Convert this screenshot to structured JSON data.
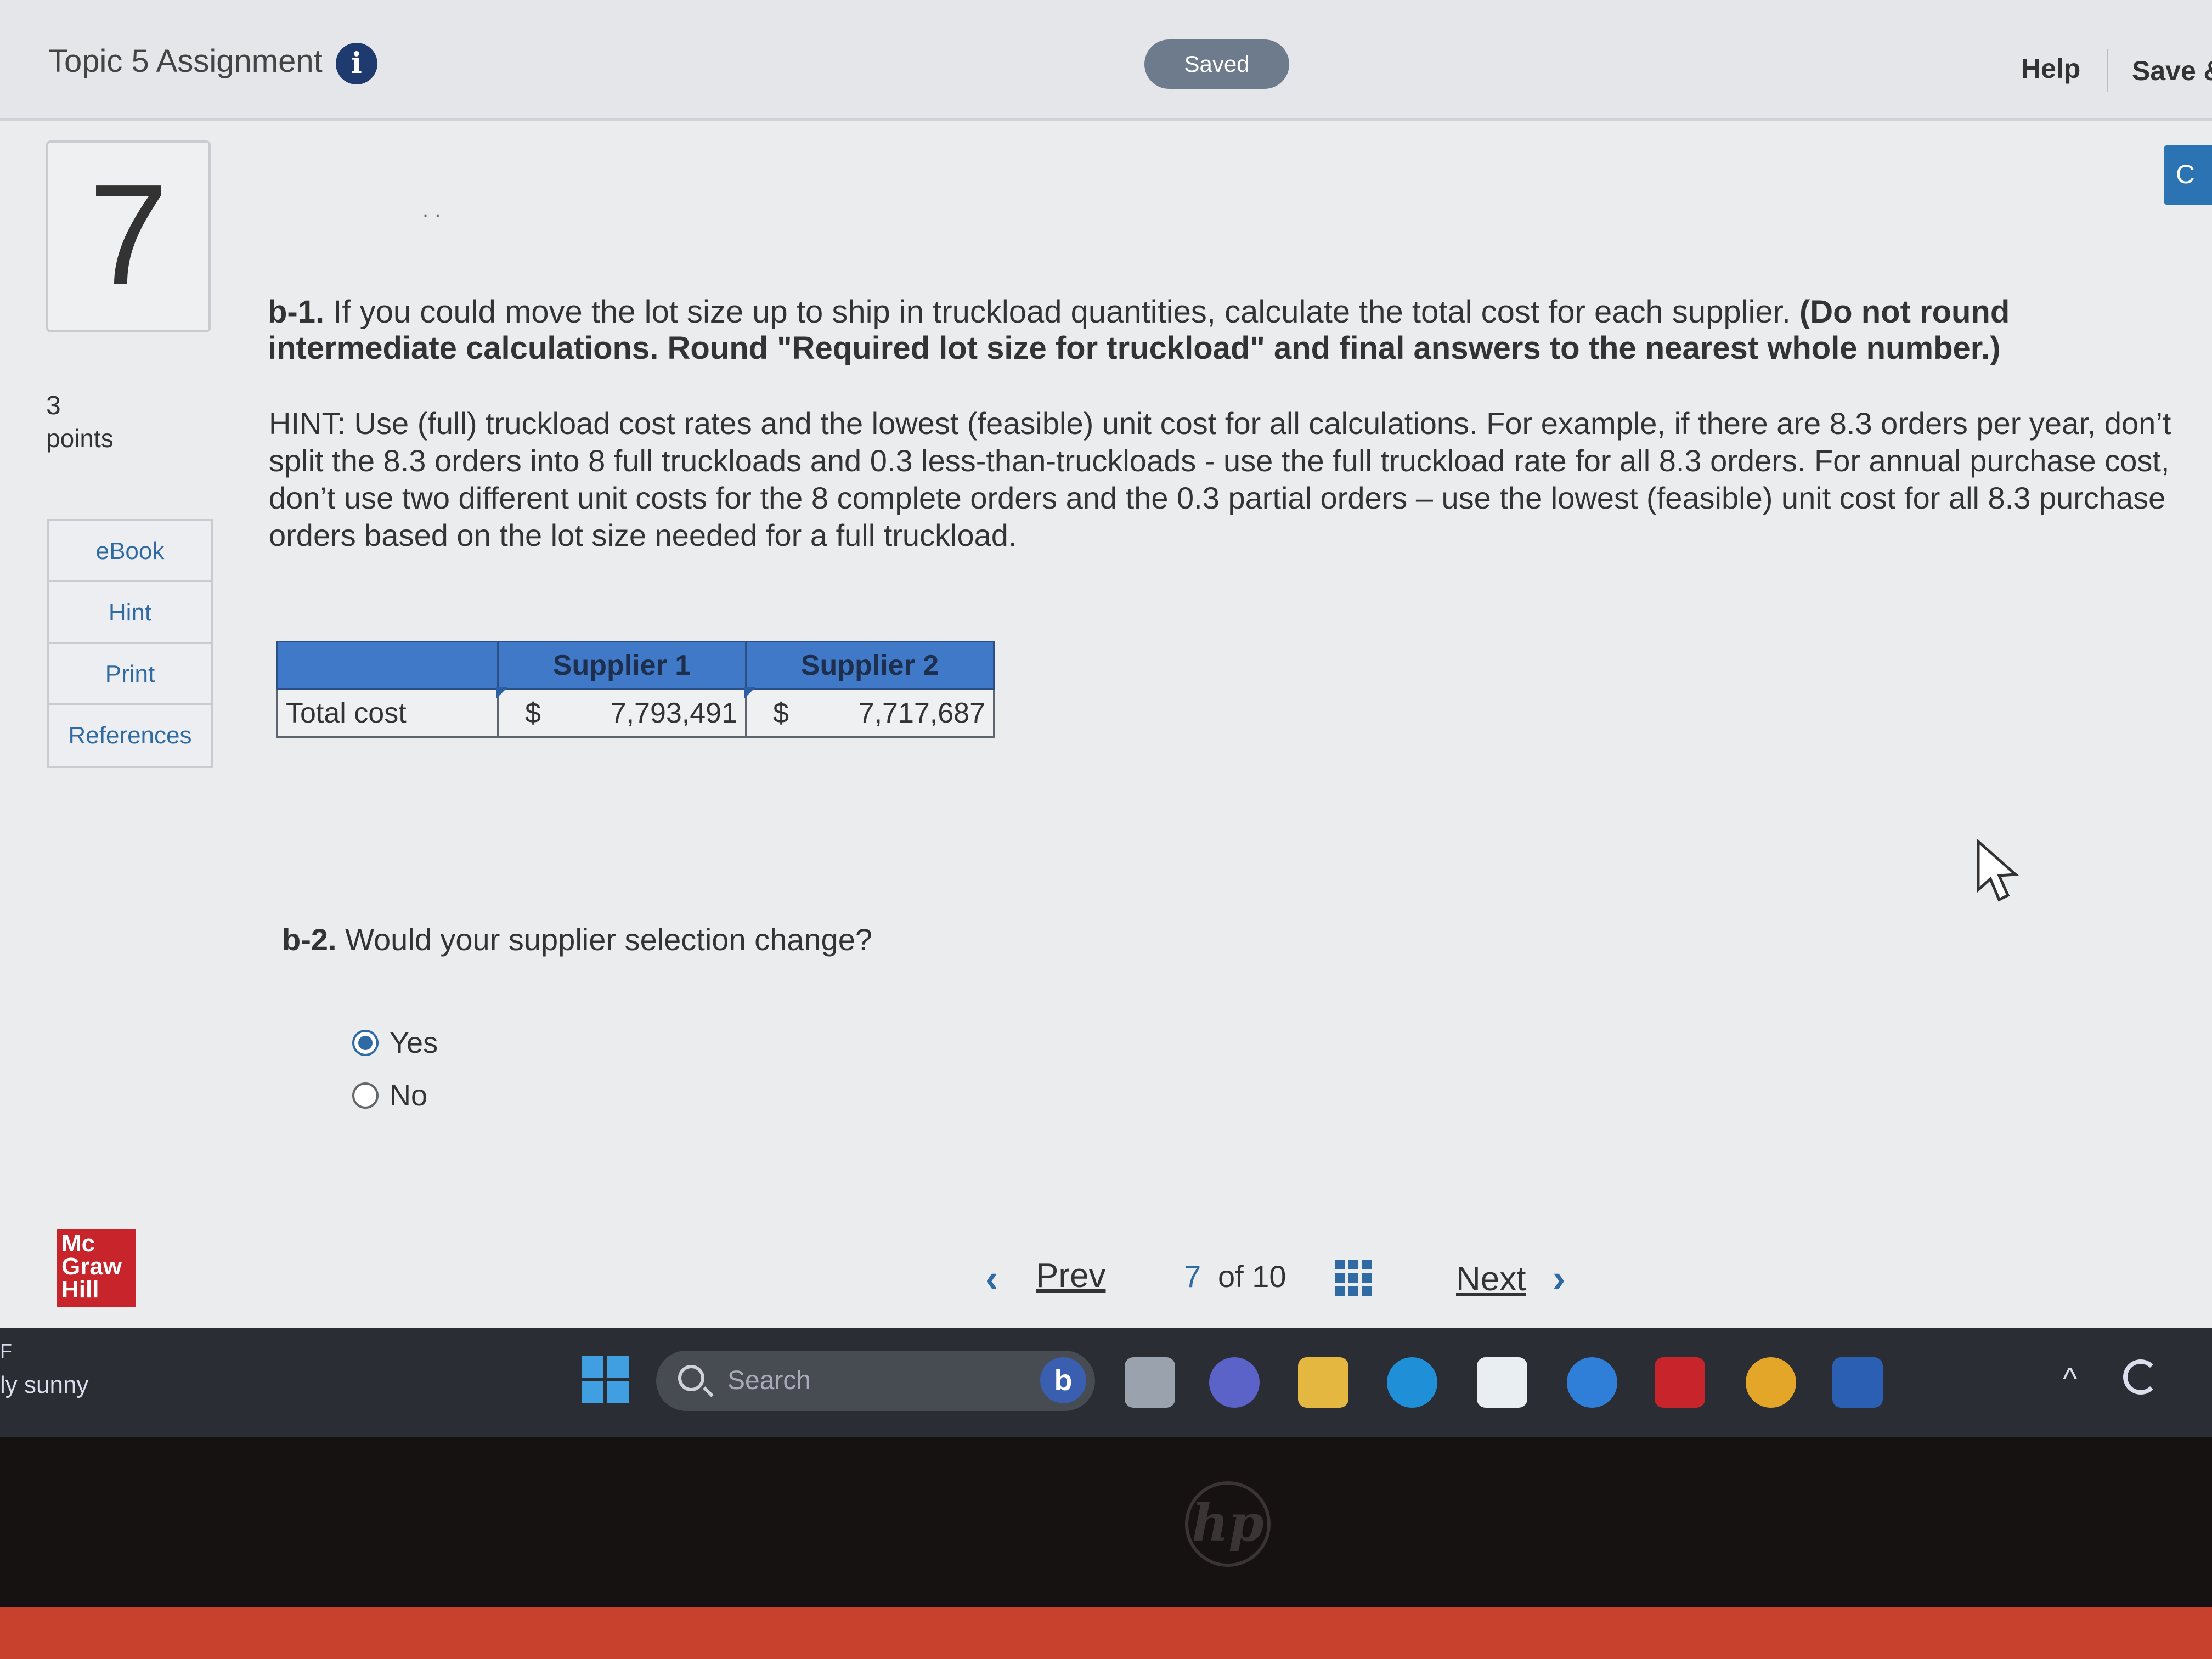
{
  "header": {
    "title": "Topic 5 Assignment",
    "info_glyph": "i",
    "status_pill": "Saved",
    "help": "Help",
    "save_exit": "Save &"
  },
  "question": {
    "number": "7",
    "points_value": "3",
    "points_label": "points",
    "dots": ". ."
  },
  "side_menu": [
    "eBook",
    "Hint",
    "Print",
    "References"
  ],
  "part_b1": {
    "label": "b-1.",
    "text": " If you could move the lot size up to ship in truckload quantities, calculate the total cost for each supplier. ",
    "instruction": "(Do not round intermediate calculations. Round \"Required lot size for truckload\" and final answers to the nearest whole number.)",
    "hint": "HINT: Use (full) truckload cost rates and the lowest (feasible) unit cost for all calculations. For example, if there are 8.3 orders per year, don’t split the 8.3 orders into 8 full truckloads and 0.3 less-than-truckloads - use the full truckload rate for all 8.3 orders. For annual purchase cost, don’t use two different unit costs for the 8 complete orders and the 0.3 partial orders – use the lowest (feasible) unit cost for all 8.3 purchase orders based on the lot size needed for a full truckload."
  },
  "table": {
    "headers": [
      "",
      "Supplier 1",
      "Supplier 2"
    ],
    "row_label": "Total cost",
    "currency": "$",
    "supplier1_value": "7,793,491",
    "supplier2_value": "7,717,687"
  },
  "part_b2": {
    "label": "b-2.",
    "text": " Would your supplier selection change?",
    "options": [
      "Yes",
      "No"
    ],
    "selected": "Yes"
  },
  "pagination": {
    "prev": "Prev",
    "current": "7",
    "of_total": "of 10",
    "next": "Next"
  },
  "brand": {
    "logo_lines": [
      "Mc",
      "Graw",
      "Hill"
    ]
  },
  "taskbar": {
    "weather_unit": "F",
    "weather": "ly sunny",
    "search_placeholder": "Search",
    "bing_letter": "b",
    "apps": [
      "file-explorer-icon",
      "teams-icon",
      "folder-icon",
      "edge-icon",
      "store-icon",
      "help-icon",
      "mcafee-icon",
      "chrome-icon",
      "word-icon"
    ]
  },
  "bezel": {
    "logo": "hp"
  },
  "colors": {
    "accent_blue": "#2f6aa3",
    "table_header": "#3f79c8",
    "logo_red": "#c8242b"
  }
}
